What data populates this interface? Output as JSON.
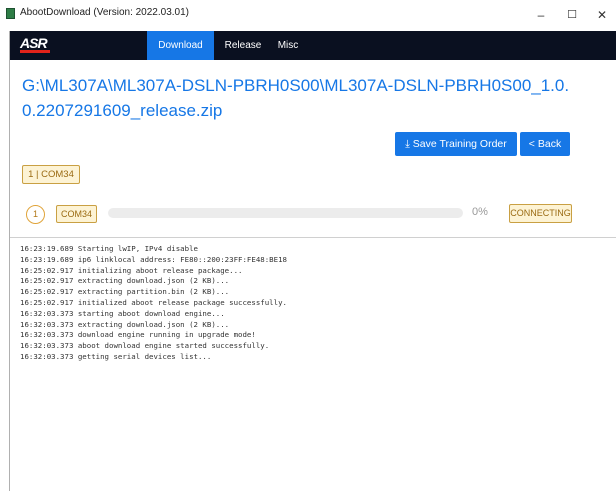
{
  "window": {
    "title": "AbootDownload (Version: 2022.03.01)",
    "min_glyph": "–",
    "max_glyph": "☐",
    "close_glyph": "✕"
  },
  "nav": {
    "logo": "ASR",
    "tabs": [
      {
        "label": "Download",
        "active": true
      },
      {
        "label": "Release",
        "active": false
      },
      {
        "label": "Misc",
        "active": false
      }
    ]
  },
  "package_path": "G:\\ML307A\\ML307A-DSLN-PBRH0S00\\ML307A-DSLN-PBRH0S00_1.0.0.2207291609_release.zip",
  "actions": {
    "save_training_order": "⤓ Save Training Order",
    "back": "< Back"
  },
  "port_chip": "1 | COM34",
  "device": {
    "index": "1",
    "port": "COM34",
    "progress": 0,
    "progress_text": "0%",
    "status": "CONNECTING"
  },
  "colors": {
    "accent": "#1677e6",
    "nav_bg": "#0a1020",
    "warning_bg": "#fdf3d4",
    "warning_border": "#c9a043"
  },
  "log": [
    "16:23:19.689 Starting lwIP, IPv4 disable",
    "16:23:19.689 ip6 linklocal address: FE80::200:23FF:FE48:BE18",
    "16:25:02.917 initializing aboot release package...",
    "16:25:02.917 extracting download.json (2 KB)...",
    "16:25:02.917 extracting partition.bin (2 KB)...",
    "16:25:02.917 initialized aboot release package successfully.",
    "16:32:03.373 starting aboot download engine...",
    "16:32:03.373 extracting download.json (2 KB)...",
    "16:32:03.373 download engine running in upgrade mode!",
    "16:32:03.373 aboot download engine started successfully.",
    "16:32:03.373 getting serial devices list..."
  ]
}
